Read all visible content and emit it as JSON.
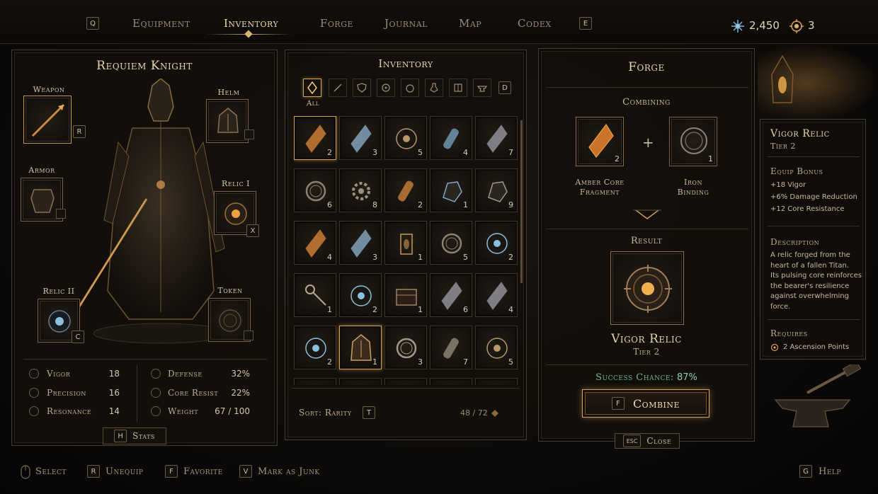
{
  "nav": {
    "left_key": "Q",
    "right_key": "E",
    "tabs": [
      {
        "label": "Equipment",
        "active": false
      },
      {
        "label": "Inventory",
        "active": true
      },
      {
        "label": "Forge",
        "active": false
      },
      {
        "label": "Journal",
        "active": false
      },
      {
        "label": "Map",
        "active": false
      },
      {
        "label": "Codex",
        "active": false
      }
    ]
  },
  "currency": {
    "shards": "2,450",
    "points": "3"
  },
  "equipment": {
    "title": "Requiem Knight",
    "slots": {
      "weapon": {
        "label": "Weapon",
        "key": "R"
      },
      "helm": {
        "label": "Helm"
      },
      "armor": {
        "label": "Armor"
      },
      "relic1": {
        "label": "Relic I",
        "key": "X"
      },
      "relic2": {
        "label": "Relic II",
        "key": "C"
      },
      "token": {
        "label": "Token"
      }
    },
    "stats_left": [
      {
        "label": "Vigor",
        "value": "18"
      },
      {
        "label": "Precision",
        "value": "16"
      },
      {
        "label": "Resonance",
        "value": "14"
      }
    ],
    "stats_right": [
      {
        "label": "Defense",
        "value": "32%"
      },
      {
        "label": "Core Resist",
        "value": "22%"
      },
      {
        "label": "Weight",
        "value": "67 / 100"
      }
    ],
    "stats_key": "H",
    "stats_label": "Stats"
  },
  "inventory": {
    "title": "Inventory",
    "filter_all_label": "All",
    "filter_key": "D",
    "items": [
      {
        "icon": "amber-crystal-icon",
        "count": "2",
        "selected": true,
        "color": "#e08a3a"
      },
      {
        "icon": "blue-crystal-icon",
        "count": "3",
        "color": "#8fb4cf"
      },
      {
        "icon": "gear-relic-icon",
        "count": "5",
        "color": "#b89868"
      },
      {
        "icon": "vial-icon",
        "count": "4",
        "color": "#7fb0d0"
      },
      {
        "icon": "dark-crystal-icon",
        "count": "7",
        "color": "#a0a0a8"
      },
      {
        "icon": "iron-ring-icon",
        "count": "6",
        "color": "#8a8070"
      },
      {
        "icon": "cog-icon",
        "count": "8",
        "color": "#9a9080"
      },
      {
        "icon": "amber-vial-icon",
        "count": "2",
        "color": "#e09040"
      },
      {
        "icon": "blue-ore-icon",
        "count": "1",
        "color": "#7fa8c8"
      },
      {
        "icon": "iron-ore-icon",
        "count": "9",
        "color": "#a09888"
      },
      {
        "icon": "amber-crystal-icon",
        "count": "4",
        "color": "#e08a3a"
      },
      {
        "icon": "blue-crystal-icon",
        "count": "3",
        "color": "#8fb4cf"
      },
      {
        "icon": "lantern-icon",
        "count": "1",
        "color": "#c89858"
      },
      {
        "icon": "iron-ring-icon",
        "count": "5",
        "color": "#8a8070"
      },
      {
        "icon": "blue-relic-icon",
        "count": "2",
        "color": "#8ac0e0"
      },
      {
        "icon": "key-icon",
        "count": "1",
        "color": "#b8a888"
      },
      {
        "icon": "blue-relic-icon",
        "count": "2",
        "color": "#8ac0e0"
      },
      {
        "icon": "chest-icon",
        "count": "1",
        "color": "#a08060"
      },
      {
        "icon": "dark-crystal-icon",
        "count": "6",
        "color": "#a0a0a8"
      },
      {
        "icon": "dark-crystal-icon",
        "count": "4",
        "color": "#a0a0a8"
      },
      {
        "icon": "blue-relic-icon",
        "count": "2",
        "color": "#8ac0e0"
      },
      {
        "icon": "helm-icon",
        "count": "1",
        "selected": true,
        "color": "#c8a060"
      },
      {
        "icon": "ring-icon",
        "count": "3",
        "color": "#a09888"
      },
      {
        "icon": "vial-icon",
        "count": "7",
        "color": "#a09888"
      },
      {
        "icon": "gear-relic-icon",
        "count": "5",
        "color": "#b89868"
      }
    ],
    "sort_label": "Sort: Rarity",
    "sort_key": "T",
    "capacity": "48 / 72"
  },
  "forge": {
    "title": "Forge",
    "combining_label": "Combining",
    "ingredient1": {
      "name_line1": "Amber Core",
      "name_line2": "Fragment",
      "count": "2"
    },
    "ingredient2": {
      "name_line1": "Iron",
      "name_line2": "Binding",
      "count": "1"
    },
    "plus": "+",
    "result_label": "Result",
    "result_name": "Vigor Relic",
    "result_tier": "Tier 2",
    "success_label": "Success Chance:",
    "success_value": "87%",
    "combine_key": "F",
    "combine_label": "Combine",
    "close_key": "ESC",
    "close_label": "Close"
  },
  "tooltip": {
    "name": "Vigor Relic",
    "tier": "Tier 2",
    "equip_bonus_label": "Equip Bonus",
    "bonuses": [
      "+18 Vigor",
      "+6% Damage Reduction",
      "+12 Core Resistance"
    ],
    "description_label": "Description",
    "description_lines": [
      "A relic forged from the",
      "heart of a fallen Titan.",
      "Its pulsing core reinforces",
      "the bearer's resilience",
      "against overwhelming",
      "force."
    ],
    "requires_label": "Requires",
    "requires_value": "2 Ascension Points"
  },
  "hints": {
    "select": "Select",
    "unequip_key": "R",
    "unequip": "Unequip",
    "favorite_key": "F",
    "favorite": "Favorite",
    "junk_key": "V",
    "junk": "Mark as Junk",
    "help_key": "G",
    "help": "Help"
  }
}
